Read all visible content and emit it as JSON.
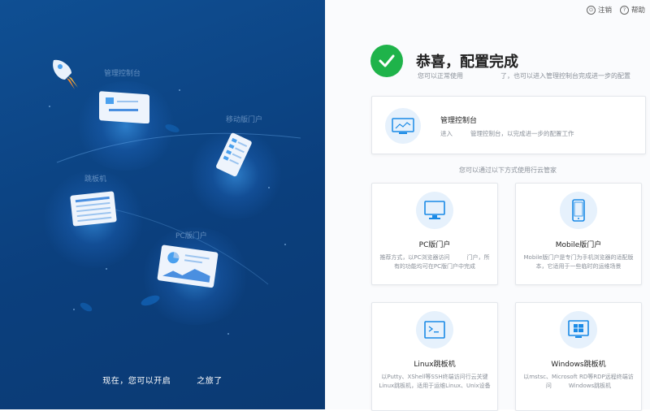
{
  "left_panel": {
    "labels": {
      "console": "管理控制台",
      "mobile": "移动版门户",
      "jump": "跳板机",
      "pc": "PC版门户"
    },
    "bottom_text": {
      "before": "现在，您可以开启",
      "after": "之旅了"
    }
  },
  "topbar": {
    "logout_label": "注销",
    "help_label": "帮助",
    "logout_icon": "power-icon",
    "help_icon": "question-icon"
  },
  "success": {
    "title": "恭喜，配置完成",
    "subtitle_before": "您可以正常使用",
    "subtitle_after": "了，也可以进入管理控制台完成进一步的配置",
    "icon": "check-icon",
    "color": "#1fb34a"
  },
  "console": {
    "title": "管理控制台",
    "desc_before": "进入",
    "desc_after": "管理控制台，以完成进一步的配置工作",
    "icon": "console-icon"
  },
  "divider_text": "您可以通过以下方式使用行云管家",
  "options": [
    {
      "title": "PC版门户",
      "desc": "推荐方式，以PC浏览器访问　　　门户，所有的功能均可在PC版门户中完成",
      "icon": "monitor-icon"
    },
    {
      "title": "Mobile版门户",
      "desc": "Mobile版门户是专门为手机浏览器的适配版本，它适用于一些临时的运维场景",
      "icon": "phone-icon"
    },
    {
      "title": "Linux跳板机",
      "desc": "以Putty、XShell等SSH终端访问行云关键Linux跳板机，适用于运维Linux、Unix设备",
      "icon": "terminal-icon"
    },
    {
      "title": "Windows跳板机",
      "desc": "以mstsc、Microsoft RD等RDP远程终端访问　　　Windows跳板机",
      "icon": "windows-icon"
    }
  ],
  "colors": {
    "left_bg": "#0f4f93",
    "accent": "#1a8ae6",
    "icon_bg": "#e6f1fc"
  }
}
